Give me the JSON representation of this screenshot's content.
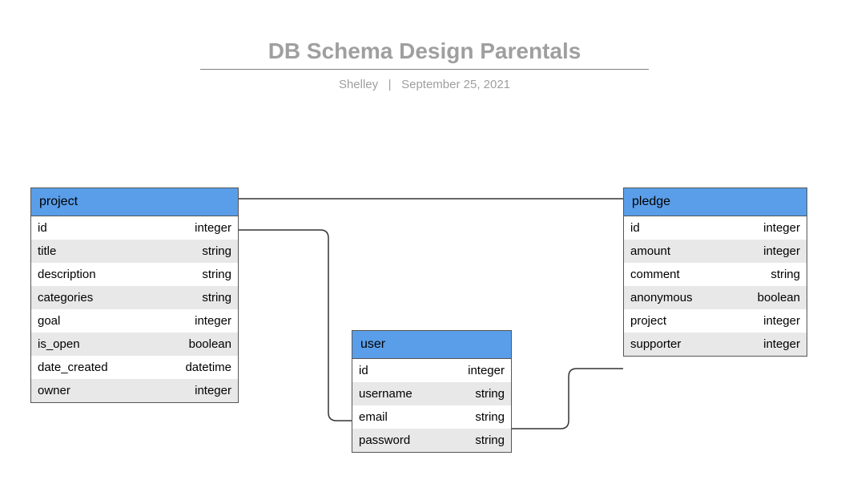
{
  "header": {
    "title": "DB Schema Design Parentals",
    "author": "Shelley",
    "separator": "|",
    "date": "September 25, 2021"
  },
  "tables": {
    "project": {
      "name": "project",
      "columns": [
        {
          "name": "id",
          "type": "integer"
        },
        {
          "name": "title",
          "type": "string"
        },
        {
          "name": "description",
          "type": "string"
        },
        {
          "name": "categories",
          "type": "string"
        },
        {
          "name": "goal",
          "type": "integer"
        },
        {
          "name": "is_open",
          "type": "boolean"
        },
        {
          "name": "date_created",
          "type": "datetime"
        },
        {
          "name": "owner",
          "type": "integer"
        }
      ]
    },
    "user": {
      "name": "user",
      "columns": [
        {
          "name": "id",
          "type": "integer"
        },
        {
          "name": "username",
          "type": "string"
        },
        {
          "name": "email",
          "type": "string"
        },
        {
          "name": "password",
          "type": "string"
        }
      ]
    },
    "pledge": {
      "name": "pledge",
      "columns": [
        {
          "name": "id",
          "type": "integer"
        },
        {
          "name": "amount",
          "type": "integer"
        },
        {
          "name": "comment",
          "type": "string"
        },
        {
          "name": "anonymous",
          "type": "boolean"
        },
        {
          "name": "project",
          "type": "integer"
        },
        {
          "name": "supporter",
          "type": "integer"
        }
      ]
    }
  },
  "relationships": [
    {
      "from": "project",
      "to": "pledge",
      "fromField": "id",
      "toField": "project"
    },
    {
      "from": "project.owner",
      "to": "user.id"
    },
    {
      "from": "pledge.supporter",
      "to": "user.id"
    }
  ]
}
